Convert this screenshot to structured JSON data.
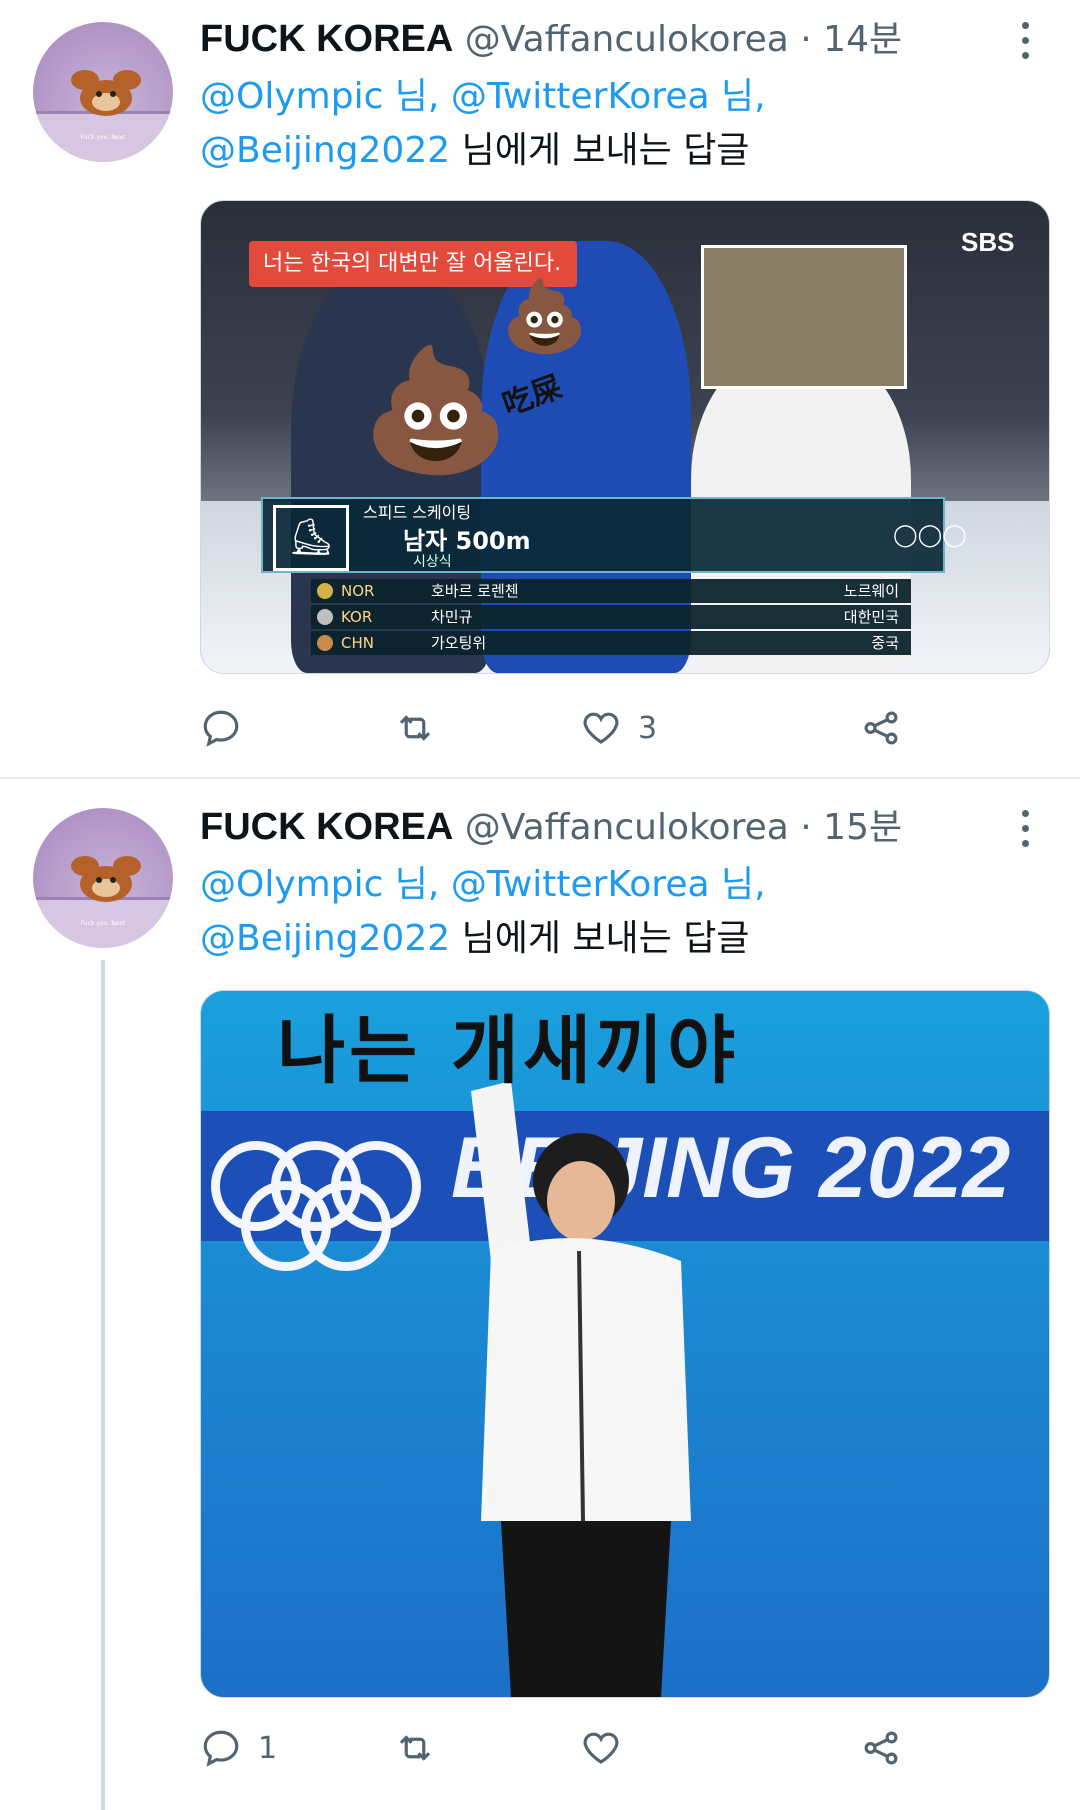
{
  "tweets": [
    {
      "display_name": "FUCK KOREA",
      "handle": "@Vaffanculokorea",
      "separator": "·",
      "time": "14분",
      "reply_to": {
        "m1": "@Olympic",
        "s1": " 님, ",
        "m2": "@TwitterKorea",
        "s2": " 님,",
        "m3": "@Beijing2022",
        "suffix": " 님에게 보내는 답글"
      },
      "avatar_caption": "Fuck you. Next",
      "media": {
        "caption": "너는 한국의 대변만 잘 어울린다.",
        "broadcaster": "SBS",
        "sticker_text": "吃屎",
        "scoreboard": {
          "sport": "스피드 스케이팅",
          "event": "남자 500m",
          "ceremony": "시상식",
          "rows": [
            {
              "code": "NOR",
              "name": "호바르 로렌첸",
              "country": "노르웨이"
            },
            {
              "code": "KOR",
              "name": "차민규",
              "country": "대한민국"
            },
            {
              "code": "CHN",
              "name": "가오팅위",
              "country": "중국"
            }
          ]
        }
      },
      "actions": {
        "reply": "",
        "retweet": "",
        "like": "3"
      }
    },
    {
      "display_name": "FUCK KOREA",
      "handle": "@Vaffanculokorea",
      "separator": "·",
      "time": "15분",
      "reply_to": {
        "m1": "@Olympic",
        "s1": " 님, ",
        "m2": "@TwitterKorea",
        "s2": " 님,",
        "m3": "@Beijing2022",
        "suffix": " 님에게 보내는 답글"
      },
      "avatar_caption": "Fuck you. Next",
      "media": {
        "overlay_text": "나는 개새끼야",
        "banner_text": "BEIJING 2022"
      },
      "actions": {
        "reply": "1",
        "retweet": "",
        "like": ""
      }
    }
  ],
  "colors": {
    "link": "#1d9bf0",
    "muted": "#536471",
    "text": "#0f1419"
  },
  "icons": [
    "more-icon",
    "reply-icon",
    "retweet-icon",
    "like-icon",
    "share-icon"
  ]
}
